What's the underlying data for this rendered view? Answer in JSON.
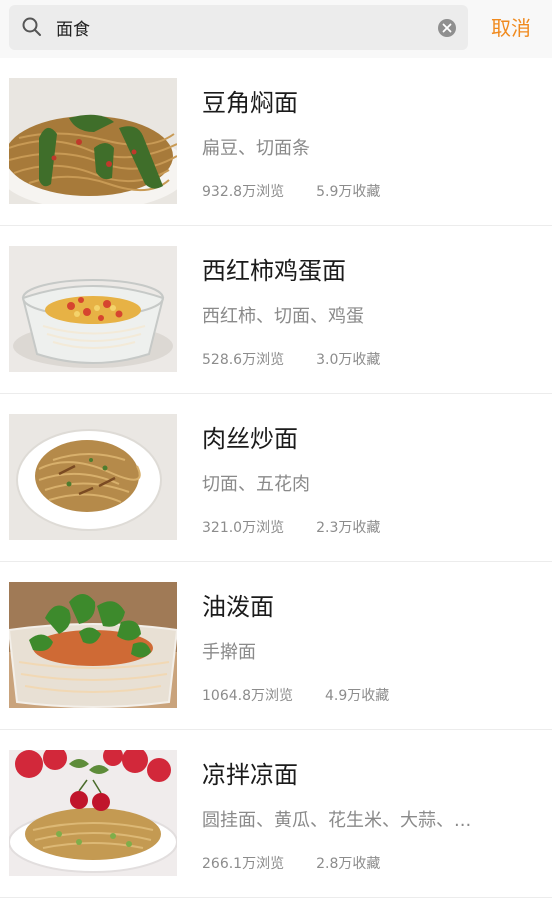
{
  "search": {
    "value": "面食",
    "cancel_label": "取消",
    "icon": "search-icon",
    "clear_icon": "clear-icon"
  },
  "colors": {
    "accent": "#f08a1e",
    "title": "#1b1b1b",
    "secondary": "#8a8a8a",
    "divider": "#ececec"
  },
  "results": [
    {
      "title": "豆角焖面",
      "ingredients": "扁豆、切面条",
      "views": "932.8万浏览",
      "favorites": "5.9万收藏",
      "image": "braised-noodles-with-green-beans"
    },
    {
      "title": "西红柿鸡蛋面",
      "ingredients": "西红柿、切面、鸡蛋",
      "views": "528.6万浏览",
      "favorites": "3.0万收藏",
      "image": "tomato-egg-noodles-in-glass-bowl"
    },
    {
      "title": "肉丝炒面",
      "ingredients": "切面、五花肉",
      "views": "321.0万浏览",
      "favorites": "2.3万收藏",
      "image": "shredded-pork-fried-noodles"
    },
    {
      "title": "油泼面",
      "ingredients": "手擀面",
      "views": "1064.8万浏览",
      "favorites": "4.9万收藏",
      "image": "oil-splashed-noodles-with-cilantro"
    },
    {
      "title": "凉拌凉面",
      "ingredients": "圆挂面、黄瓜、花生米、大蒜、...",
      "views": "266.1万浏览",
      "favorites": "2.8万收藏",
      "image": "cold-noodles-with-cherries"
    }
  ]
}
